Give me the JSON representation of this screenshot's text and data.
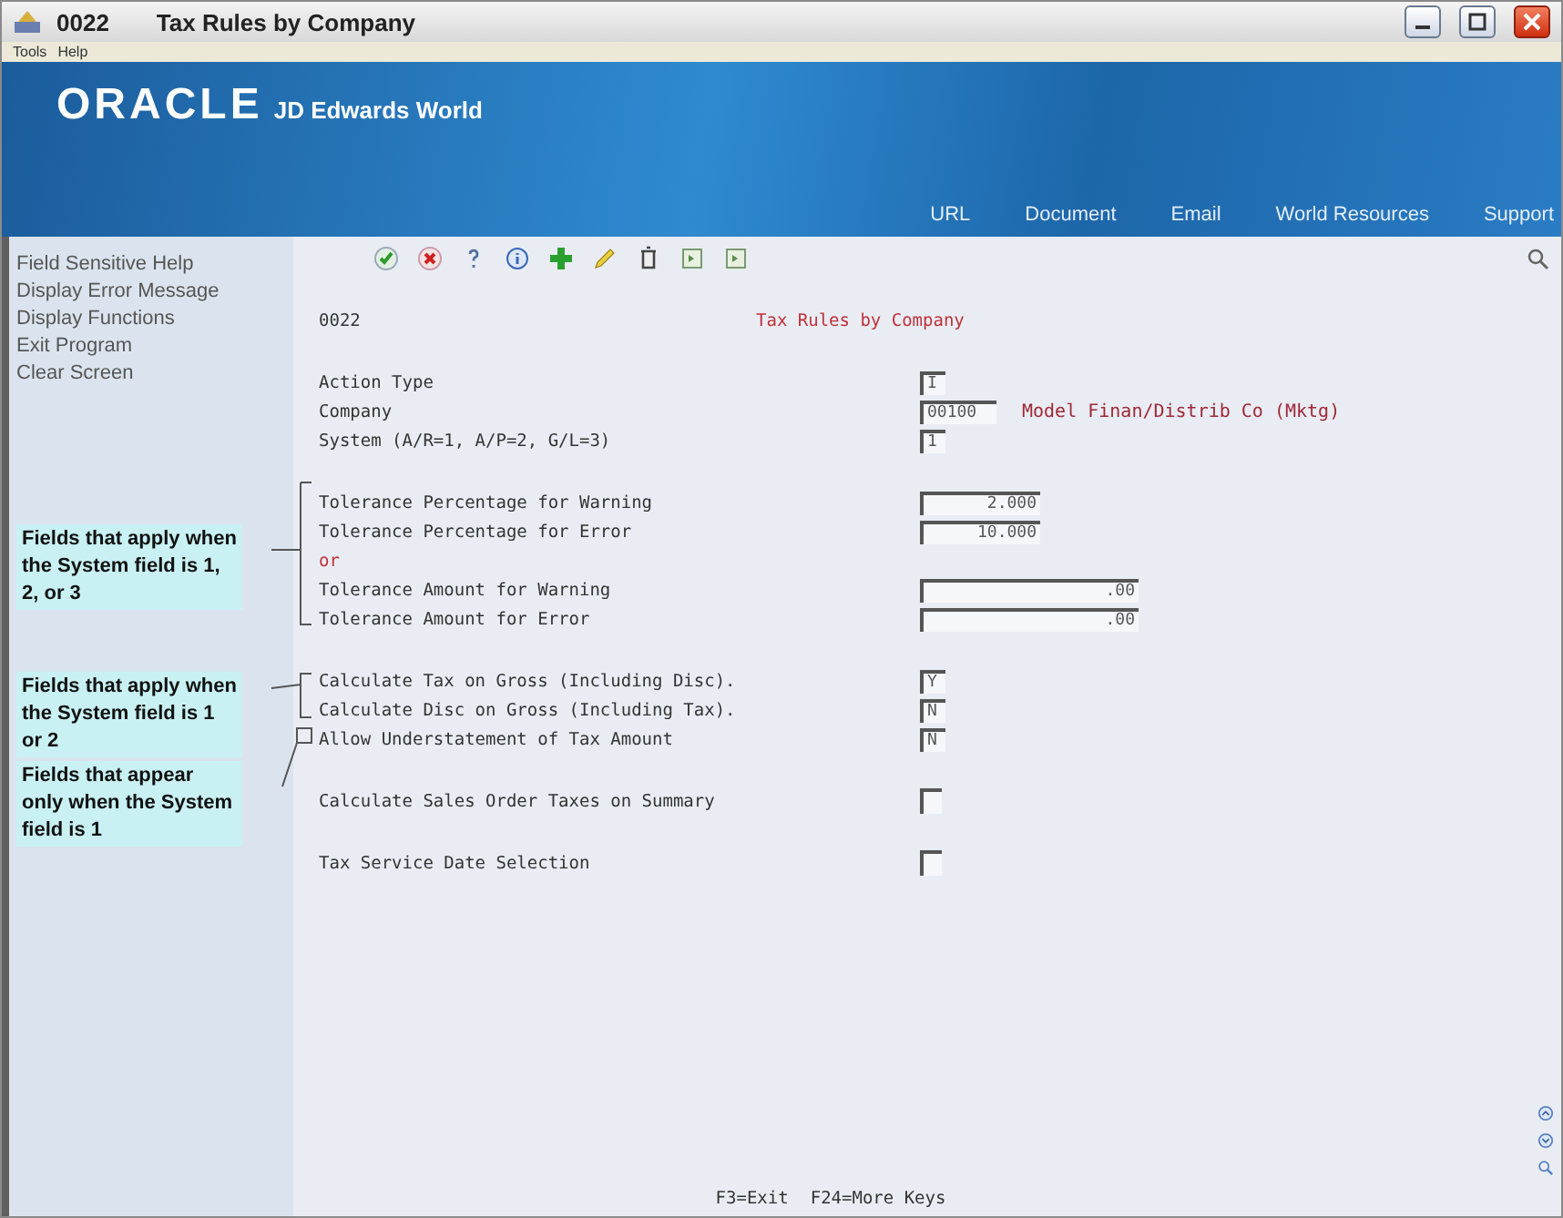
{
  "window": {
    "code": "0022",
    "title": "Tax Rules by Company"
  },
  "menu": [
    "Tools",
    "Help"
  ],
  "banner": {
    "brand": "ORACLE",
    "product": "JD Edwards World",
    "links": [
      "URL",
      "Document",
      "Email",
      "World Resources",
      "Support"
    ]
  },
  "sidebar": {
    "items": [
      "Field Sensitive Help",
      "Display Error Message",
      "Display Functions",
      "Exit Program",
      "Clear Screen"
    ],
    "callouts": [
      "Fields that apply when the System field is 1, 2, or 3",
      "Fields that apply when the System field is 1 or 2",
      "Fields that appear only when the System field is 1"
    ]
  },
  "form": {
    "program": "0022",
    "heading": "Tax Rules by Company",
    "groups": [
      [
        {
          "kind": "code",
          "label": "Action Type",
          "value": "I"
        },
        {
          "kind": "company",
          "label": "Company",
          "value": "00100",
          "description": "Model Finan/Distrib Co (Mktg)"
        },
        {
          "kind": "code",
          "label": "System (A/R=1, A/P=2, G/L=3)",
          "value": "1"
        }
      ],
      [
        {
          "kind": "percent",
          "label": "Tolerance Percentage for Warning",
          "value": "2.000"
        },
        {
          "kind": "percent",
          "label": "Tolerance Percentage for Error",
          "value": "10.000"
        },
        {
          "kind": "note",
          "label": "or"
        },
        {
          "kind": "amount",
          "label": "Tolerance Amount for Warning",
          "value": ".00"
        },
        {
          "kind": "amount",
          "label": "Tolerance Amount for Error",
          "value": ".00"
        }
      ],
      [
        {
          "kind": "flag",
          "label": "Calculate Tax on Gross (Including Disc).",
          "value": "Y"
        },
        {
          "kind": "flag",
          "label": "Calculate Disc on Gross (Including Tax).",
          "value": "N"
        },
        {
          "kind": "flag",
          "label": "Allow Understatement of Tax Amount",
          "value": "N"
        }
      ],
      [
        {
          "kind": "checkbox",
          "label": "Calculate Sales Order Taxes on Summary",
          "checked": false
        }
      ],
      [
        {
          "kind": "checkbox",
          "label": "Tax Service Date Selection",
          "checked": false
        }
      ]
    ]
  },
  "footer": [
    "F3=Exit",
    "F24=More Keys"
  ]
}
